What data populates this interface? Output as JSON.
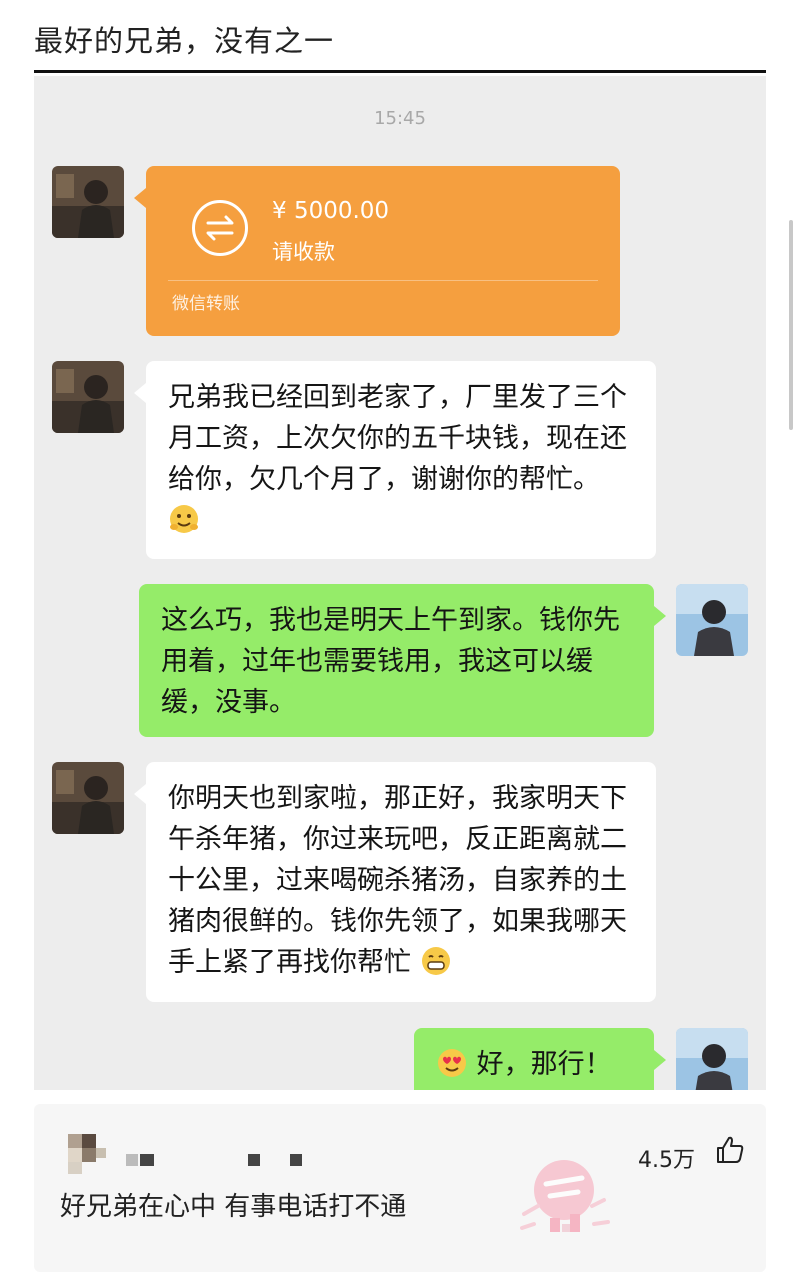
{
  "post": {
    "title": "最好的兄弟，没有之一"
  },
  "chat": {
    "timestamp": "15:45",
    "transfer": {
      "currency": "¥",
      "amount": "¥ 5000.00",
      "note": "请收款",
      "label": "微信转账",
      "color": "#f59f3f"
    },
    "messages": [
      {
        "side": "left",
        "text": "兄弟我已经回到老家了，厂里发了三个月工资，上次欠你的五千块钱，现在还给你，欠几个月了，谢谢你的帮忙。",
        "emoji": "hugging-face-icon"
      },
      {
        "side": "right",
        "text": "这么巧，我也是明天上午到家。钱你先用着，过年也需要钱用，我这可以缓缓，没事。"
      },
      {
        "side": "left",
        "text": "你明天也到家啦，那正好，我家明天下午杀年猪，你过来玩吧，反正距离就二十公里，过来喝碗杀猪汤，自家养的土猪肉很鲜的。钱你先领了，如果我哪天手上紧了再找你帮忙",
        "emoji": "grinning-face-icon"
      },
      {
        "side": "right",
        "text": "好，那行！",
        "emoji": "heart-eyes-face-icon"
      }
    ],
    "colors": {
      "left_bubble": "#ffffff",
      "right_bubble": "#95ec69",
      "background": "#ededed"
    }
  },
  "comment": {
    "text": "好兄弟在心中 有事电话打不通",
    "likes": "4.5万",
    "stamp_icon": "shenping-stamp-icon"
  }
}
